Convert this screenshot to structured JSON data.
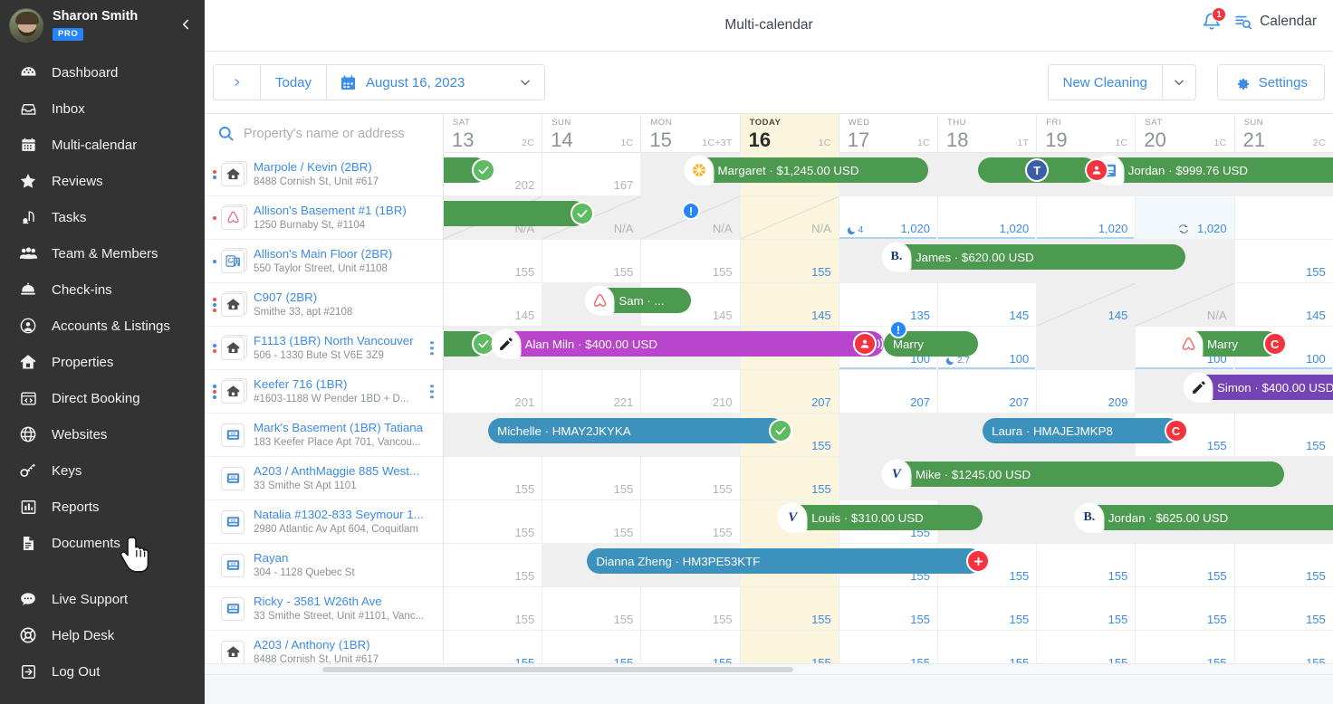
{
  "sidebar": {
    "user": {
      "name": "Sharon Smith",
      "plan_badge": "PRO"
    },
    "collapse_icon": "chevron-left-icon",
    "items": [
      {
        "label": "Dashboard",
        "icon": "dashboard-icon"
      },
      {
        "label": "Inbox",
        "icon": "inbox-icon"
      },
      {
        "label": "Multi-calendar",
        "icon": "calendar-icon"
      },
      {
        "label": "Reviews",
        "icon": "star-icon"
      },
      {
        "label": "Tasks",
        "icon": "vacuum-icon"
      },
      {
        "label": "Team & Members",
        "icon": "users-icon"
      },
      {
        "label": "Check-ins",
        "icon": "bell-service-icon"
      },
      {
        "label": "Accounts & Listings",
        "icon": "user-circle-icon"
      },
      {
        "label": "Properties",
        "icon": "home-icon"
      },
      {
        "label": "Direct Booking",
        "icon": "code-window-icon"
      },
      {
        "label": "Websites",
        "icon": "globe-icon"
      },
      {
        "label": "Keys",
        "icon": "key-icon"
      },
      {
        "label": "Reports",
        "icon": "bar-chart-icon"
      },
      {
        "label": "Documents",
        "icon": "document-icon"
      }
    ],
    "footer_items": [
      {
        "label": "Live Support",
        "icon": "chat-icon"
      },
      {
        "label": "Help Desk",
        "icon": "lifebuoy-icon"
      },
      {
        "label": "Log Out",
        "icon": "logout-icon"
      }
    ]
  },
  "topbar": {
    "title": "Multi-calendar",
    "notification_count": "1",
    "view_switch_label": "Calendar"
  },
  "toolbar": {
    "next_arrow": "›",
    "today_label": "Today",
    "date_label": "August 16, 2023",
    "new_cleaning_label": "New Cleaning",
    "settings_label": "Settings"
  },
  "search": {
    "placeholder": "Property's name or address",
    "value": ""
  },
  "days": [
    {
      "dow": "SAT",
      "num": "13",
      "count": "2C",
      "today": false
    },
    {
      "dow": "SUN",
      "num": "14",
      "count": "1C",
      "today": false
    },
    {
      "dow": "MON",
      "num": "15",
      "count": "1C+3T",
      "today": false
    },
    {
      "dow": "TODAY",
      "num": "16",
      "count": "1C",
      "today": true
    },
    {
      "dow": "WED",
      "num": "17",
      "count": "1C",
      "today": false
    },
    {
      "dow": "THU",
      "num": "18",
      "count": "1T",
      "today": false
    },
    {
      "dow": "FRI",
      "num": "19",
      "count": "1C",
      "today": false
    },
    {
      "dow": "SAT",
      "num": "20",
      "count": "1C",
      "today": false
    },
    {
      "dow": "SUN",
      "num": "21",
      "count": "2C",
      "today": false
    }
  ],
  "properties": [
    {
      "name": "Marpole / Kevin (2BR)",
      "address": "8488 Cornish St, Unit #617",
      "icon": "home-icon",
      "dots": [
        "red",
        "blue"
      ],
      "kebab": false
    },
    {
      "name": "Allison's Basement #1 (1BR)",
      "address": "1250 Burnaby St, #1104",
      "icon": "airbnb-icon",
      "dots": [
        "red"
      ],
      "kebab": false
    },
    {
      "name": "Allison's Main Floor (2BR)",
      "address": "550 Taylor Street, Unit #1108",
      "icon": "sync-home-icon",
      "dots": [
        "blue"
      ],
      "kebab": false
    },
    {
      "name": "C907 (2BR)",
      "address": "Smithe 33, apt #2108",
      "icon": "home-icon",
      "dots": [
        "red",
        "blue",
        "red"
      ],
      "kebab": false
    },
    {
      "name": "F1113 (1BR) North Vancouver",
      "address": "506 - 1330 Bute St V6E 3Z9",
      "icon": "home-icon",
      "dots": [
        "blue",
        "red"
      ],
      "kebab": true
    },
    {
      "name": "Keefer 716 (1BR)",
      "address": "#1603-1188 W Pender 1BD + D...",
      "icon": "home-icon",
      "dots": [
        "blue",
        "red",
        "blue"
      ],
      "kebab": true
    },
    {
      "name": "Mark's Basement (1BR) Tatiana",
      "address": "183 Keefer Place Apt 701, Vancou...",
      "icon": "booking-icon",
      "dots": [],
      "kebab": false
    },
    {
      "name": "A203 / AnthMaggie 885 West...",
      "address": "33 Smithe St Apt 1101",
      "icon": "booking-icon",
      "dots": [],
      "kebab": false
    },
    {
      "name": "Natalia #1302-833 Seymour 1...",
      "address": "2980 Atlantic Av Apt 604, Coquitlam",
      "icon": "booking-icon",
      "dots": [],
      "kebab": false
    },
    {
      "name": "Rayan",
      "address": "304 - 1128 Quebec St",
      "icon": "booking-icon",
      "dots": [],
      "kebab": false
    },
    {
      "name": "Ricky - 3581 W26th Ave",
      "address": "33 Smithe Street, Unit #1101, Vanc...",
      "icon": "booking-icon",
      "dots": [],
      "kebab": false
    },
    {
      "name": "A203 / Anthony (1BR)",
      "address": "8488 Cornish St, Unit #617",
      "icon": "home-icon",
      "dots": [],
      "kebab": false
    }
  ],
  "cells": [
    [
      {
        "v": "202"
      },
      {
        "v": "167"
      },
      {
        "v": "",
        "grey": true
      },
      {
        "v": "",
        "today": true,
        "grey": true
      },
      {
        "v": "",
        "grey": true
      },
      {
        "v": "",
        "grey": true
      },
      {
        "v": "",
        "grey": true
      },
      {
        "v": "",
        "grey": true
      },
      {
        "v": "",
        "grey": true
      }
    ],
    [
      {
        "v": "N/A",
        "diag": true,
        "grey": true
      },
      {
        "v": "N/A",
        "diag": true,
        "grey": true
      },
      {
        "v": "N/A",
        "diag": true,
        "grey": true
      },
      {
        "v": "N/A",
        "today": true,
        "diag": true,
        "grey": true
      },
      {
        "v": "1,020",
        "blue": true,
        "moon": "4",
        "under": true
      },
      {
        "v": "1,020",
        "blue": true,
        "under": true
      },
      {
        "v": "1,020",
        "blue": true,
        "under": true
      },
      {
        "v": "1,020",
        "blue": true,
        "recycle": true,
        "lightblue": true
      }
    ],
    [
      {
        "v": "155"
      },
      {
        "v": "155"
      },
      {
        "v": "155"
      },
      {
        "v": "155",
        "today": true,
        "blue": true
      },
      {
        "v": "",
        "grey": true
      },
      {
        "v": "",
        "grey": true
      },
      {
        "v": "",
        "grey": true
      },
      {
        "v": "",
        "grey": true
      },
      {
        "v": "155",
        "blue": true
      }
    ],
    [
      {
        "v": "145"
      },
      {
        "v": "",
        "grey": true
      },
      {
        "v": "145"
      },
      {
        "v": "145",
        "today": true,
        "blue": true
      },
      {
        "v": "135",
        "blue": true
      },
      {
        "v": "145",
        "blue": true
      },
      {
        "v": "145",
        "blue": true,
        "diag": true,
        "grey": true
      },
      {
        "v": "N/A",
        "diag": true,
        "grey": true
      },
      {
        "v": "145",
        "blue": true
      }
    ],
    [
      {
        "v": "",
        "grey": true
      },
      {
        "v": "",
        "grey": true
      },
      {
        "v": "",
        "grey": true
      },
      {
        "v": "",
        "today": true,
        "grey": true
      },
      {
        "v": "100",
        "blue": true,
        "under": true
      },
      {
        "v": "100",
        "blue": true,
        "moon": "2.7",
        "under": true
      },
      {
        "v": "",
        "grey": true
      },
      {
        "v": "100",
        "blue": true,
        "under": true
      },
      {
        "v": "100",
        "blue": true,
        "under": true
      }
    ],
    [
      {
        "v": "201"
      },
      {
        "v": "221"
      },
      {
        "v": "210"
      },
      {
        "v": "207",
        "today": true,
        "blue": true
      },
      {
        "v": "207",
        "blue": true
      },
      {
        "v": "207",
        "blue": true
      },
      {
        "v": "209",
        "blue": true
      },
      {
        "v": "",
        "grey": true
      },
      {
        "v": "",
        "grey": true
      }
    ],
    [
      {
        "v": "",
        "grey": true
      },
      {
        "v": "",
        "grey": true
      },
      {
        "v": "",
        "grey": true
      },
      {
        "v": "155",
        "today": true,
        "blue": true
      },
      {
        "v": "",
        "grey": true
      },
      {
        "v": "",
        "grey": true
      },
      {
        "v": "",
        "grey": true
      },
      {
        "v": "155",
        "blue": true
      },
      {
        "v": "155",
        "blue": true
      }
    ],
    [
      {
        "v": "155"
      },
      {
        "v": "155"
      },
      {
        "v": "155"
      },
      {
        "v": "155",
        "today": true,
        "blue": true
      },
      {
        "v": "",
        "grey": true
      },
      {
        "v": "",
        "grey": true
      },
      {
        "v": "",
        "grey": true
      },
      {
        "v": "",
        "grey": true
      },
      {
        "v": "",
        "grey": true
      }
    ],
    [
      {
        "v": "155"
      },
      {
        "v": "155"
      },
      {
        "v": "155"
      },
      {
        "v": "",
        "today": true,
        "grey": true
      },
      {
        "v": "155",
        "blue": true
      },
      {
        "v": "",
        "grey": true
      },
      {
        "v": "",
        "grey": true
      },
      {
        "v": "",
        "grey": true
      },
      {
        "v": "",
        "grey": true
      }
    ],
    [
      {
        "v": "155"
      },
      {
        "v": "",
        "grey": true
      },
      {
        "v": "",
        "grey": true
      },
      {
        "v": "",
        "today": true,
        "grey": true
      },
      {
        "v": "155",
        "blue": true
      },
      {
        "v": "155",
        "blue": true
      },
      {
        "v": "155",
        "blue": true
      },
      {
        "v": "155",
        "blue": true
      },
      {
        "v": "155",
        "blue": true
      }
    ],
    [
      {
        "v": "155"
      },
      {
        "v": "155"
      },
      {
        "v": "155"
      },
      {
        "v": "155",
        "today": true,
        "blue": true
      },
      {
        "v": "155",
        "blue": true
      },
      {
        "v": "155",
        "blue": true
      },
      {
        "v": "155",
        "blue": true
      },
      {
        "v": "155",
        "blue": true
      },
      {
        "v": "155",
        "blue": true
      }
    ],
    [
      {
        "v": "155",
        "blue": true
      },
      {
        "v": "155",
        "blue": true
      },
      {
        "v": "155",
        "blue": true
      },
      {
        "v": "155",
        "today": true,
        "blue": true
      },
      {
        "v": "155",
        "blue": true
      },
      {
        "v": "155",
        "blue": true
      },
      {
        "v": "155",
        "blue": true
      },
      {
        "v": "155",
        "blue": true
      },
      {
        "v": "155",
        "blue": true
      }
    ]
  ],
  "reservations": [
    {
      "row": 0,
      "start": -1.0,
      "end": 0.45,
      "color": "green",
      "label": "",
      "logo": "",
      "endBadge": "check",
      "id": "res-r0-a"
    },
    {
      "row": 0,
      "start": 2.45,
      "end": 4.9,
      "color": "green",
      "label": "Margaret · $1,245.00 USD",
      "logo": "vrbo",
      "endBadge": "",
      "id": "res-r0-margaret"
    },
    {
      "row": 0,
      "start": 5.4,
      "end": 6.6,
      "color": "green",
      "label": "",
      "logo": "",
      "midBadge": "T",
      "id": "res-r0-t"
    },
    {
      "row": 0,
      "start": 6.6,
      "end": 9.6,
      "color": "green",
      "label": "Jordan · $999.76 USD",
      "logo": "booking-sq",
      "startBadge": "user",
      "id": "res-r0-jordan"
    },
    {
      "row": 1,
      "start": -1.0,
      "end": 1.45,
      "color": "green",
      "label": "",
      "logo": "",
      "endBadge": "check",
      "id": "res-r1-a"
    },
    {
      "row": 3,
      "start": 1.45,
      "end": 2.5,
      "color": "green",
      "label": "Sam · ...",
      "logo": "airbnb",
      "endBadge": "",
      "id": "res-r3-sam"
    },
    {
      "row": 2,
      "start": 4.45,
      "end": 7.5,
      "color": "green",
      "label": "James · $620.00 USD",
      "logo": "booking",
      "endBadge": "",
      "id": "res-r2-james"
    },
    {
      "row": 4,
      "start": -1.0,
      "end": 0.45,
      "color": "green",
      "label": "",
      "logo": "",
      "endBadge": "check",
      "id": "res-r4-a"
    },
    {
      "row": 4,
      "start": 0.5,
      "end": 4.45,
      "color": "purple",
      "label": "Alan Miln · $400.00 USD",
      "logo": "pencil",
      "endBadge": "user-sound",
      "id": "res-r4-alan"
    },
    {
      "row": 4,
      "start": 4.45,
      "end": 5.4,
      "color": "green",
      "label": "Marry",
      "logo": "",
      "topBadge": "info",
      "id": "res-r4-marry"
    },
    {
      "row": 4,
      "start": 7.4,
      "end": 8.45,
      "color": "green",
      "label": "Marry",
      "logo": "airbnb",
      "endBadge": "C",
      "id": "res-r4-marry2"
    },
    {
      "row": 5,
      "start": 7.5,
      "end": 10.0,
      "color": "dpurple",
      "label": "Simon · $400.00 USD",
      "logo": "pencil",
      "endBadge": "",
      "id": "res-r5-simon"
    },
    {
      "row": 6,
      "start": 0.45,
      "end": 3.45,
      "color": "blue",
      "label": "Michelle · HMAY2JKYKA",
      "logo": "",
      "endBadge": "check",
      "id": "res-r6-michelle"
    },
    {
      "row": 6,
      "start": 5.45,
      "end": 7.45,
      "color": "blue",
      "label": "Laura · HMAJEJMKP8",
      "logo": "",
      "endBadge": "C",
      "id": "res-r6-laura"
    },
    {
      "row": 7,
      "start": 4.45,
      "end": 8.5,
      "color": "green",
      "label": "Mike · $1245.00 USD",
      "logo": "vrbo-v",
      "endBadge": "",
      "id": "res-r7-mike"
    },
    {
      "row": 8,
      "start": 3.4,
      "end": 5.45,
      "color": "green",
      "label": "Louis · $310.00 USD",
      "logo": "vrbo-v",
      "endBadge": "",
      "id": "res-r8-louis"
    },
    {
      "row": 8,
      "start": 6.4,
      "end": 9.6,
      "color": "green",
      "label": "Jordan · $625.00 USD",
      "logo": "booking",
      "endBadge": "",
      "id": "res-r8-jordan"
    },
    {
      "row": 9,
      "start": 1.45,
      "end": 5.45,
      "color": "blue",
      "label": "Dianna Zheng · HM3PE53KTF",
      "logo": "",
      "endBadge": "plus",
      "id": "res-r9-dianna"
    }
  ],
  "colors": {
    "accent": "#3b8beb",
    "sidebar_bg": "#333333",
    "green": "#4c9a4f",
    "blue": "#3d91bd",
    "purple": "#b845cb",
    "dark_purple": "#7444b5",
    "red": "#f5333f",
    "today_highlight": "#fcf5dd"
  },
  "info_markers": [
    {
      "row": 1,
      "col": 2,
      "icon": "info-icon"
    }
  ]
}
